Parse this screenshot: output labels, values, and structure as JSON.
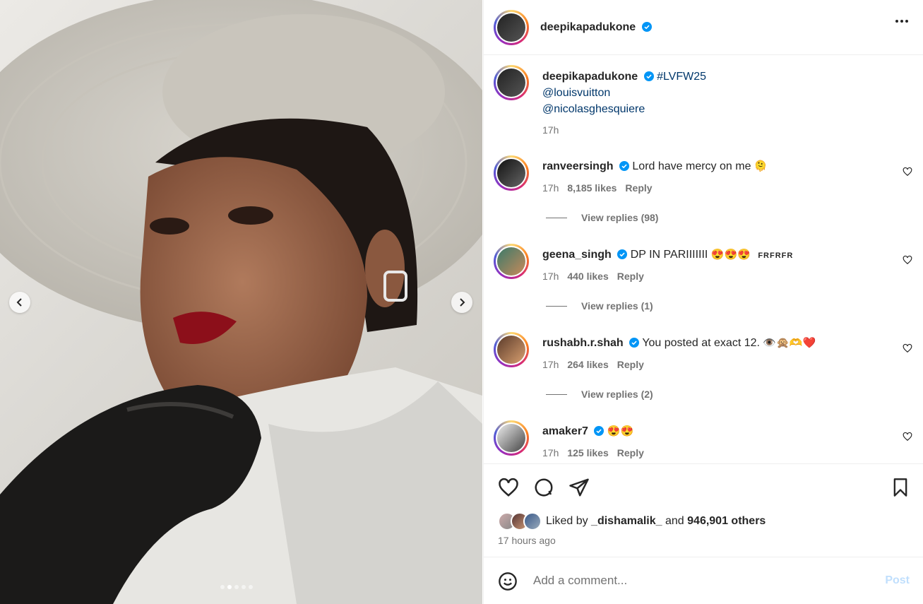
{
  "post": {
    "owner": "deepikapadukone",
    "verified": true,
    "caption": {
      "username": "deepikapadukone",
      "hashtag": "#LVFW25",
      "mentions": [
        "@louisvuitton",
        "@nicolasghesquiere"
      ],
      "time": "17h"
    },
    "comments": [
      {
        "username": "ranveersingh",
        "text": "Lord have mercy on me",
        "emoji": "🫠",
        "time": "17h",
        "likes": "8,185 likes",
        "reply": "Reply",
        "view_replies": "View replies (98)"
      },
      {
        "username": "geena_singh",
        "text": "DP IN PARIIIIIII",
        "emoji": "😍😍😍",
        "extra": "FRFRFR",
        "time": "17h",
        "likes": "440 likes",
        "reply": "Reply",
        "view_replies": "View replies (1)"
      },
      {
        "username": "rushabh.r.shah",
        "text": "You posted at exact 12.",
        "emoji": "👁️🙊🫶❤️",
        "time": "17h",
        "likes": "264 likes",
        "reply": "Reply",
        "view_replies": "View replies (2)"
      },
      {
        "username": "amaker7",
        "text": "",
        "emoji": "😍😍",
        "time": "17h",
        "likes": "125 likes",
        "reply": "Reply"
      }
    ],
    "liked_by": {
      "prefix": "Liked by ",
      "user": "_dishamalik_",
      "middle": " and ",
      "count": "946,901 others"
    },
    "time_ago": "17 hours ago",
    "add_comment": {
      "placeholder": "Add a comment...",
      "post_label": "Post"
    },
    "carousel": {
      "slides": 5,
      "active": 1
    }
  },
  "icons": {
    "verified": "verified-badge-icon",
    "more": "more-options-icon",
    "like": "heart-icon",
    "comment": "comment-bubble-icon",
    "share": "paper-plane-icon",
    "save": "bookmark-icon",
    "emoji": "smiley-icon",
    "prev": "chevron-left-icon",
    "next": "chevron-right-icon"
  },
  "colors": {
    "verified": "#0095f6",
    "link": "#00376b",
    "muted": "#737373",
    "post_disabled": "#c0dffd"
  }
}
